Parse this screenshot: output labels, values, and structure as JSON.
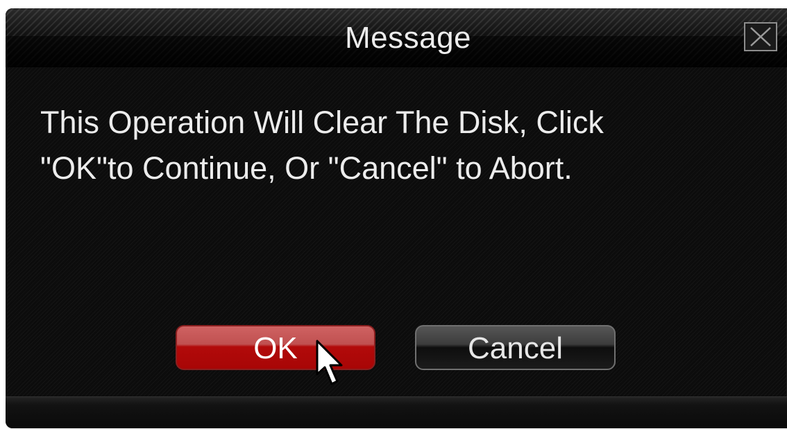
{
  "dialog": {
    "title": "Message",
    "message_lines": [
      "This Operation Will Clear The Disk, Click",
      "\"OK\"to Continue, Or \"Cancel\" to Abort."
    ],
    "ok_label": "OK",
    "cancel_label": "Cancel",
    "close_icon": "close-icon"
  },
  "cursor": {
    "icon": "mouse-pointer-icon"
  },
  "colors": {
    "ok_button": "#b20a0a",
    "cancel_button": "#3c3c3c",
    "background": "#0c0c0c",
    "text": "#ececec"
  }
}
